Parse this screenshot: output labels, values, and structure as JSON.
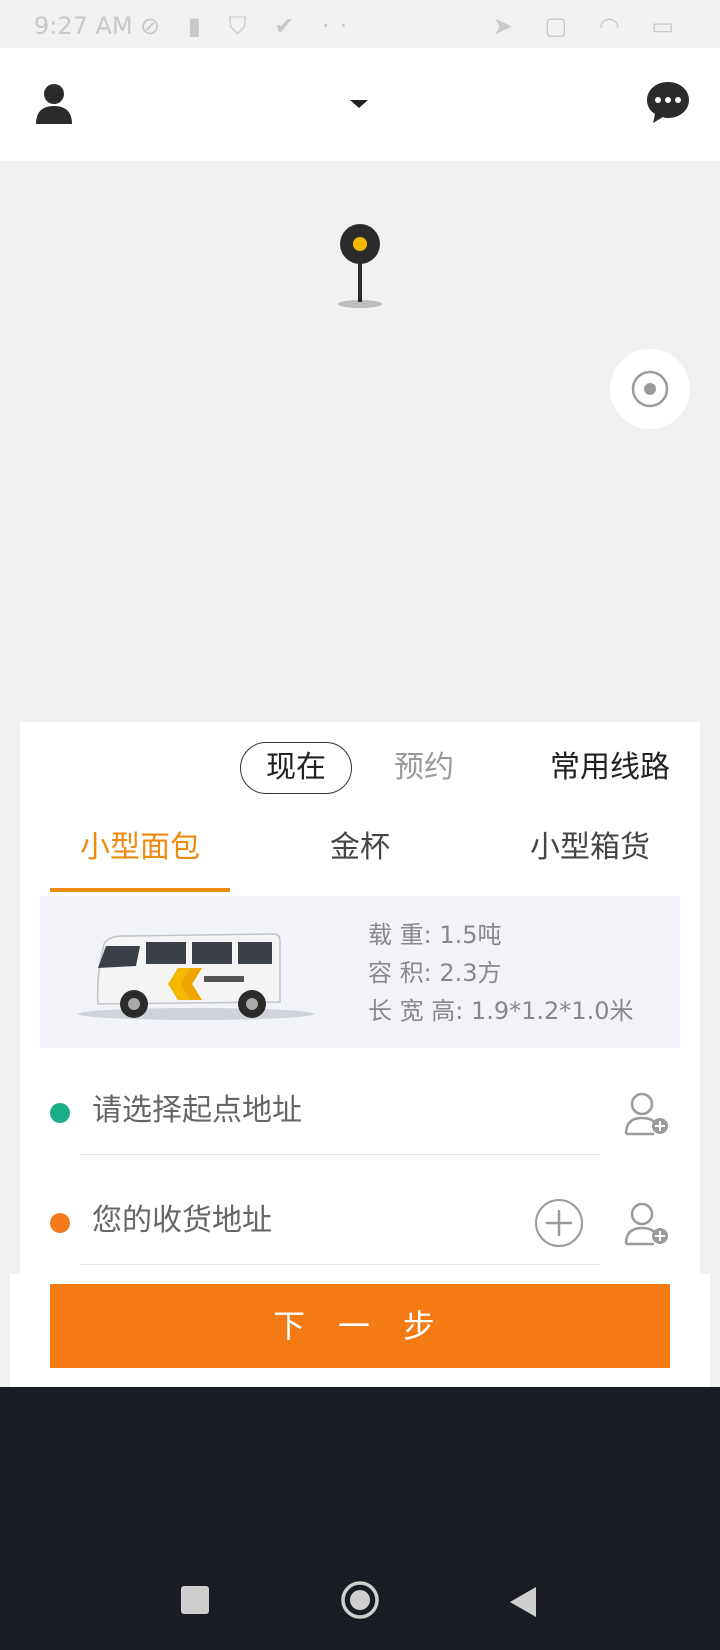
{
  "status_bar": {
    "time": "9:27 AM",
    "left_icons": [
      "sync-off-icon",
      "trash-icon",
      "shield-icon",
      "check-icon",
      "more-icon"
    ],
    "right_icons": [
      "location-icon",
      "sim-off-icon",
      "wifi-icon",
      "battery-icon"
    ]
  },
  "header": {
    "profile_icon": "person-icon",
    "city_dropdown_icon": "caret-down-icon",
    "chat_icon": "chat-icon"
  },
  "map": {
    "pin_color": "#f5b800",
    "locate_icon": "locate-icon"
  },
  "time_tabs": {
    "now": "现在",
    "reserve": "预约",
    "routes": "常用线路"
  },
  "vehicle_tabs": [
    "小型面包",
    "金杯",
    "小型箱货"
  ],
  "vehicle": {
    "load": "载 重: 1.5吨",
    "volume": "容 积: 2.3方",
    "dimensions": "长 宽 高: 1.9*1.2*1.0米"
  },
  "address": {
    "start_placeholder": "请选择起点地址",
    "end_placeholder": "您的收货地址"
  },
  "next_button": "下 一 步",
  "colors": {
    "accent": "#f47a14",
    "tab_active": "#ee8a0e",
    "start_dot": "#1aad89",
    "end_dot": "#f47a1c"
  }
}
